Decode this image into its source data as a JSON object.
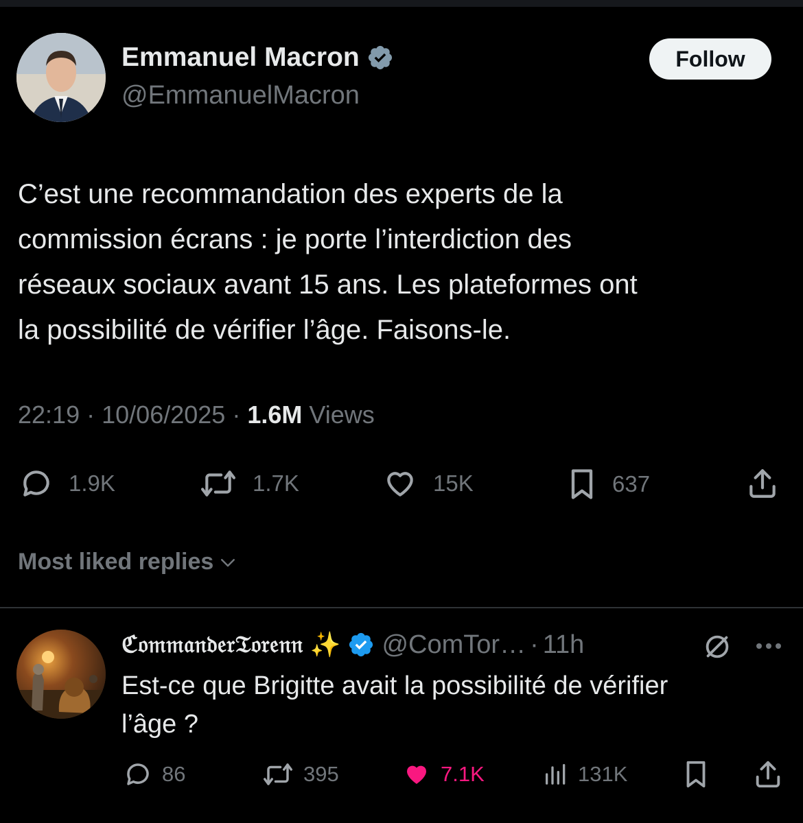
{
  "tweet": {
    "author_name": "Emmanuel Macron",
    "author_handle": "@EmmanuelMacron",
    "follow_label": "Follow",
    "text_lines": [
      "C’est une recommandation des experts de la",
      "commission écrans : je porte l’interdiction des",
      "réseaux sociaux avant 15 ans. Les plateformes ont",
      "la possibilité de vérifier l’âge. Faisons-le."
    ],
    "time": "22:19",
    "date": "10/06/2025",
    "views_count": "1.6M",
    "views_label": "Views",
    "separator": "·",
    "replies": "1.9K",
    "reposts": "1.7K",
    "likes": "15K",
    "bookmarks": "637"
  },
  "replies_section": {
    "sort_label": "Most liked replies"
  },
  "reply": {
    "author_name": "ℭ𝔬𝔪𝔪𝔞𝔫𝔡𝔢𝔯𝔗𝔬𝔯𝔢𝔫𝔫",
    "author_emoji": "✨",
    "author_handle": "@ComTor…",
    "time": "11h",
    "separator": "·",
    "text_lines": [
      "Est-ce que Brigitte avait la possibilité de vérifier",
      "l’âge ?"
    ],
    "replies": "86",
    "reposts": "395",
    "likes": "7.1K",
    "views": "131K"
  },
  "colors": {
    "background": "#000000",
    "text_primary": "#e7e9ea",
    "text_secondary": "#71767b",
    "verified_blue": "#1d9bf0",
    "verified_gray": "#829aab",
    "like_pink": "#f91880",
    "follow_bg": "#eff3f4"
  },
  "icons": {
    "reply": "reply-icon",
    "repost": "repost-icon",
    "like": "heart-icon",
    "bookmark": "bookmark-icon",
    "share": "share-icon",
    "views": "views-icon",
    "grok": "grok-icon",
    "more": "more-icon",
    "chevron": "chevron-down-icon"
  }
}
